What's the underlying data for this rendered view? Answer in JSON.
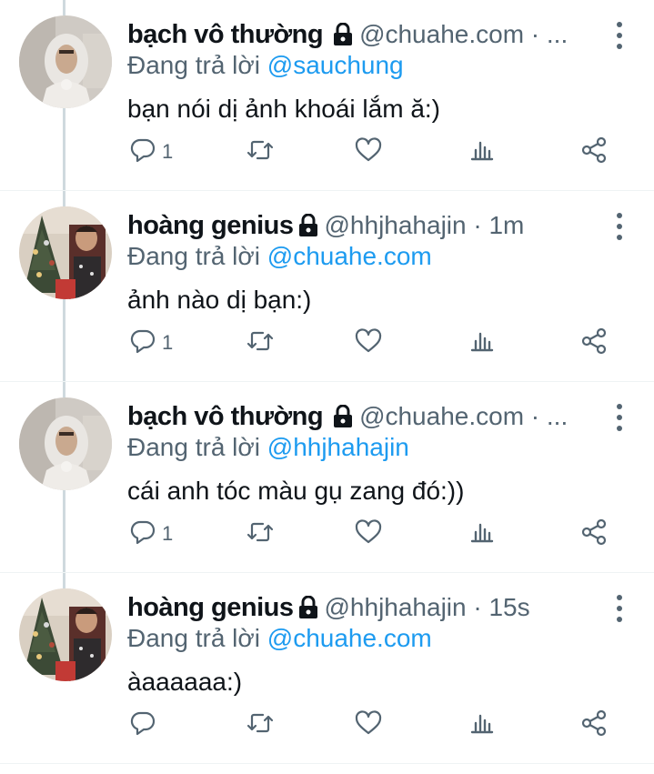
{
  "colors": {
    "accent": "#1d9bf0",
    "secondary_text": "#536471",
    "primary_text": "#0f1419"
  },
  "tweets": [
    {
      "display_name": "bạch vô thường",
      "meta": "@chuahe.com · ...",
      "reply_prefix": "Đang trả lời",
      "reply_to": "@sauchung",
      "text": "bạn nói dị ảnh khoái lắm ă:)",
      "reply_count": "1",
      "avatar": "white-hood-portrait"
    },
    {
      "display_name": "hoàng genius",
      "meta": "@hhjhahajin · 1m",
      "reply_prefix": "Đang trả lời",
      "reply_to": "@chuahe.com",
      "text": "ảnh nào dị bạn:)",
      "reply_count": "1",
      "avatar": "christmas-tree-photo"
    },
    {
      "display_name": "bạch vô thường",
      "meta": "@chuahe.com · ...",
      "reply_prefix": "Đang trả lời",
      "reply_to": "@hhjhahajin",
      "text": "cái anh tóc màu gụ zang đó:))",
      "reply_count": "1",
      "avatar": "white-hood-portrait"
    },
    {
      "display_name": "hoàng genius",
      "meta": "@hhjhahajin · 15s",
      "reply_prefix": "Đang trả lời",
      "reply_to": "@chuahe.com",
      "text": "àaaaaaa:)",
      "reply_count": "",
      "avatar": "christmas-tree-photo"
    }
  ],
  "action_icons": [
    "reply-icon",
    "retweet-icon",
    "like-icon",
    "views-icon",
    "share-icon"
  ]
}
